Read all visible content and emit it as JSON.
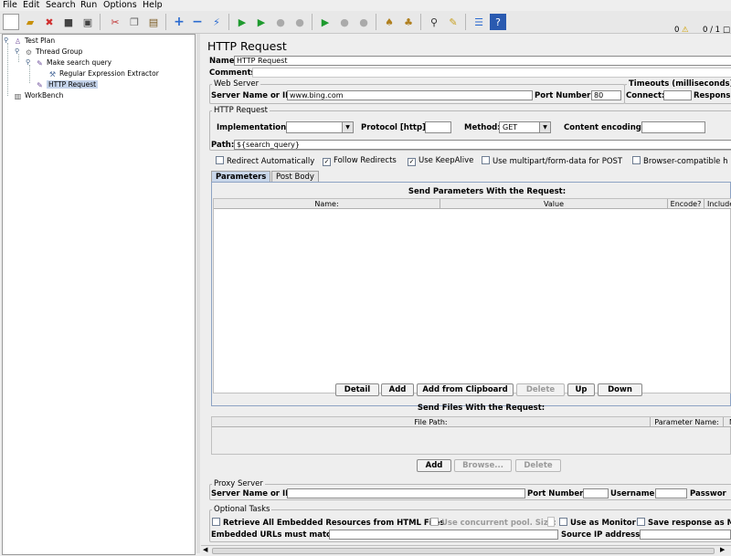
{
  "menu": {
    "items": [
      "File",
      "Edit",
      "Search",
      "Run",
      "Options",
      "Help"
    ]
  },
  "toolbar": {
    "icons": [
      "new-icon",
      "open-icon",
      "close-icon",
      "save-icon",
      "save-as-icon",
      "cut-icon",
      "copy-icon",
      "paste-icon",
      "expand-icon",
      "collapse-icon",
      "toggle-icon",
      "start-icon",
      "start-no-pause-icon",
      "stop-icon",
      "shutdown-icon",
      "remote-start-icon",
      "remote-stop-icon",
      "remote-shutdown-icon",
      "clear-icon",
      "clear-all-icon",
      "search-icon",
      "reset-search-icon",
      "function-helper-icon",
      "help-icon"
    ],
    "warning_count": "0",
    "thread_count": "0 / 1"
  },
  "tree": {
    "test_plan": "Test Plan",
    "thread_group": "Thread Group",
    "controller": "Make search query",
    "extractor": "Regular Expression Extractor",
    "sampler": "HTTP Request",
    "workbench": "WorkBench"
  },
  "panel": {
    "title": "HTTP Request",
    "name_label": "Name:",
    "name_value": "HTTP Request",
    "comments_label": "Comments:",
    "web_server": {
      "title": "Web Server",
      "server_label": "Server Name or IP:",
      "server_value": "www.bing.com",
      "port_label": "Port Number:",
      "port_value": "80"
    },
    "timeouts": {
      "title": "Timeouts (milliseconds)",
      "connect_label": "Connect:",
      "response_label": "Respons"
    },
    "http_request": {
      "title": "HTTP Request",
      "implementation_label": "Implementation:",
      "implementation_value": "",
      "protocol_label": "Protocol [http]:",
      "protocol_value": "",
      "method_label": "Method:",
      "method_value": "GET",
      "encoding_label": "Content encoding:",
      "encoding_value": "",
      "path_label": "Path:",
      "path_value": "${search_query}"
    },
    "options": {
      "redirect_auto": "Redirect Automatically",
      "follow_redirects": "Follow Redirects",
      "keepalive": "Use KeepAlive",
      "multipart": "Use multipart/form-data for POST",
      "browser_headers": "Browser-compatible h"
    },
    "tabs": [
      "Parameters",
      "Post Body"
    ],
    "params": {
      "title": "Send Parameters With the Request:",
      "columns": [
        "Name:",
        "Value",
        "Encode?",
        "Include"
      ]
    },
    "param_buttons": [
      "Detail",
      "Add",
      "Add from Clipboard",
      "Delete",
      "Up",
      "Down"
    ],
    "files": {
      "title": "Send Files With the Request:",
      "columns": [
        "File Path:",
        "Parameter Name:",
        "M"
      ]
    },
    "file_buttons": [
      "Add",
      "Browse...",
      "Delete"
    ],
    "proxy": {
      "title": "Proxy Server",
      "server_label": "Server Name or IP:",
      "port_label": "Port Number:",
      "user_label": "Username",
      "pass_label": "Passwor"
    },
    "optional": {
      "title": "Optional Tasks",
      "retrieve": "Retrieve All Embedded Resources from HTML Files",
      "pool": "Use concurrent pool. Size:",
      "monitor": "Use as Monitor",
      "save_md5": "Save response as M",
      "embedded_label": "Embedded URLs must match:",
      "source_ip_label": "Source IP address:"
    }
  }
}
